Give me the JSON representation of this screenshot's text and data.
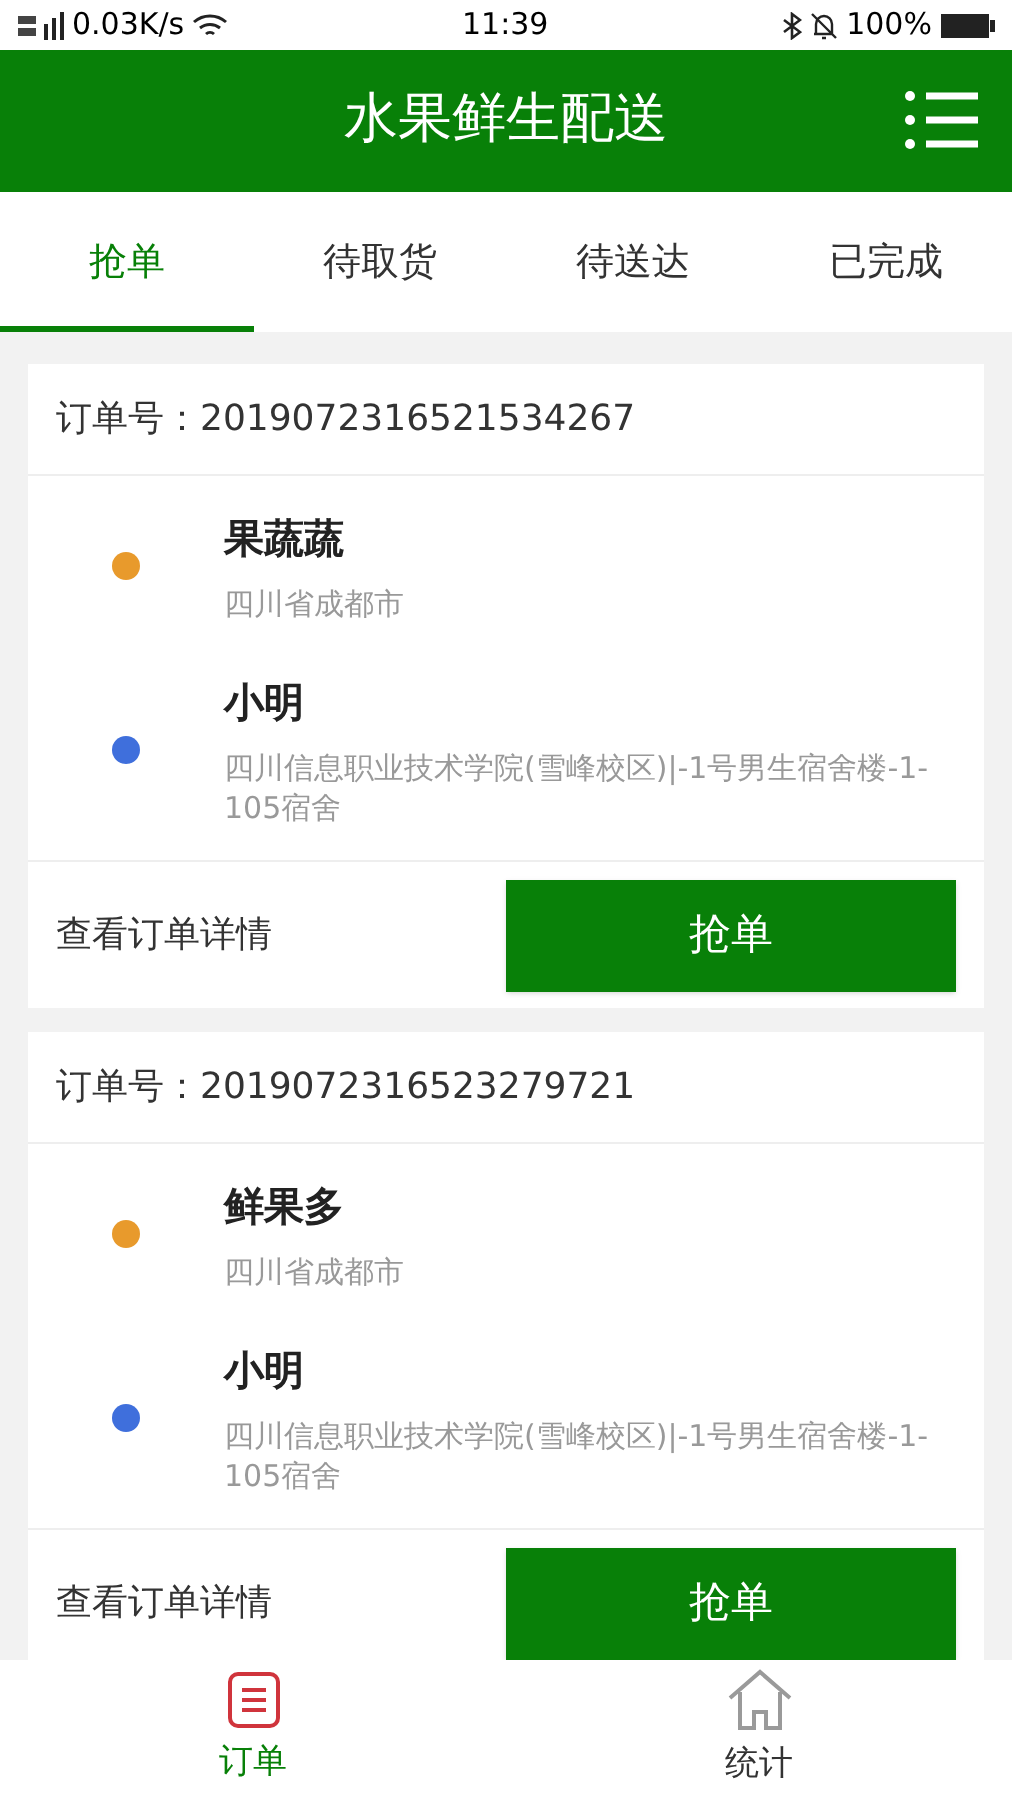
{
  "status_bar": {
    "speed": "0.03K/s",
    "time": "11:39",
    "battery": "100%"
  },
  "header": {
    "title": "水果鲜生配送"
  },
  "tabs": [
    {
      "label": "抢单",
      "selected": true
    },
    {
      "label": "待取货",
      "selected": false
    },
    {
      "label": "待送达",
      "selected": false
    },
    {
      "label": "已完成",
      "selected": false
    }
  ],
  "orders": [
    {
      "order_label": "订单号：",
      "order_no": "2019072316521534267",
      "stops": [
        {
          "name": "果蔬蔬",
          "address": "四川省成都市",
          "color": "#e89a2c"
        },
        {
          "name": "小明",
          "address": "四川信息职业技术学院(雪峰校区)|-1号男生宿舍楼-1-105宿舍",
          "color": "#3f6fdc"
        }
      ],
      "details_link": "查看订单详情",
      "action": "抢单"
    },
    {
      "order_label": "订单号：",
      "order_no": "2019072316523279721",
      "stops": [
        {
          "name": "鲜果多",
          "address": "四川省成都市",
          "color": "#e89a2c"
        },
        {
          "name": "小明",
          "address": "四川信息职业技术学院(雪峰校区)|-1号男生宿舍楼-1-105宿舍",
          "color": "#3f6fdc"
        }
      ],
      "details_link": "查看订单详情",
      "action": "抢单"
    }
  ],
  "bottom_nav": [
    {
      "label": "订单",
      "kind": "orders",
      "selected": true
    },
    {
      "label": "统计",
      "kind": "stats",
      "selected": false
    }
  ]
}
